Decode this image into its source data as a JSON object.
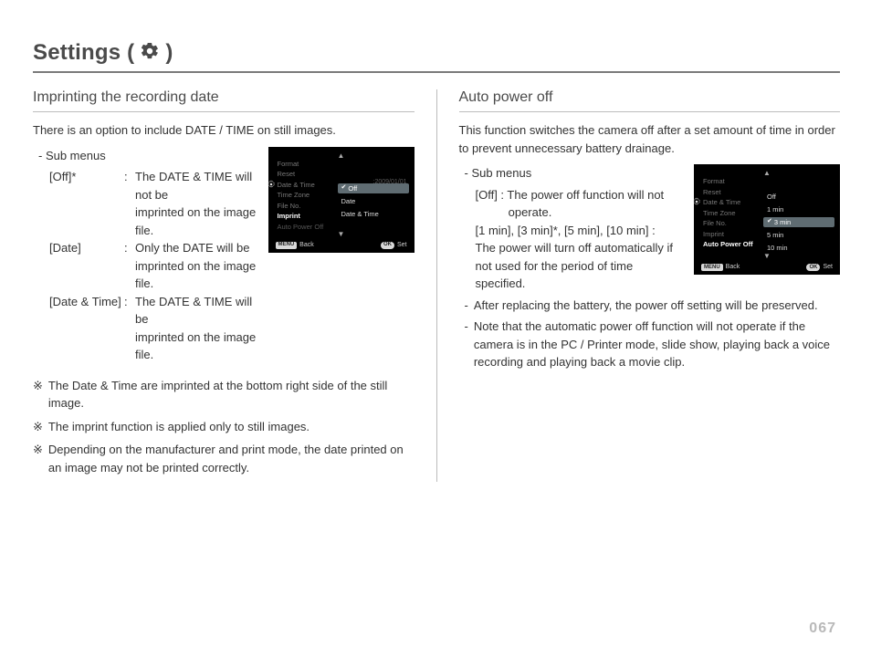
{
  "page_title_prefix": "Settings ( ",
  "page_title_suffix": " )",
  "page_number": "067",
  "left": {
    "heading": "Imprinting the recording date",
    "intro": "There is an option to include DATE / TIME on still images.",
    "submenu_label": "- Sub menus",
    "defs": [
      {
        "key": "[Off]*",
        "sep": ":",
        "val_1": "The DATE & TIME will not be",
        "val_2": "imprinted on the image file."
      },
      {
        "key": "[Date]",
        "sep": ":",
        "val_1": "Only the DATE will be",
        "val_2": "imprinted on the image file."
      },
      {
        "key": "[Date & Time]",
        "sep": ":",
        "val_1": "The DATE & TIME will be",
        "val_2": "imprinted on the image file."
      }
    ],
    "notes_sym": "※",
    "notes": [
      "The Date & Time are imprinted at the bottom right side of the still image.",
      "The imprint function is applied only to still images.",
      "Depending on the manufacturer and print mode, the date printed on an image may not be printed correctly."
    ],
    "cam": {
      "menu_items": [
        {
          "label": "Format",
          "style": "dim"
        },
        {
          "label": "Reset",
          "style": "dim"
        },
        {
          "label": "Date & Time",
          "style": "dim",
          "right_value": ":2009/01/01"
        },
        {
          "label": "Time Zone",
          "style": "dim"
        },
        {
          "label": "File No.",
          "style": "dim"
        },
        {
          "label": "Imprint",
          "style": "active"
        },
        {
          "label": "Auto Power Off",
          "style": "dimmer"
        }
      ],
      "options": [
        {
          "label": "Off",
          "selected": true,
          "checked": true
        },
        {
          "label": "Date",
          "selected": false,
          "checked": false
        },
        {
          "label": "Date & Time",
          "selected": false,
          "checked": false
        }
      ],
      "footer_left_pill": "MENU",
      "footer_left_label": "Back",
      "footer_right_pill": "OK",
      "footer_right_label": "Set"
    }
  },
  "right": {
    "heading": "Auto power off",
    "intro": "This function switches the camera off after a set amount of time in order to prevent unnecessary battery drainage.",
    "submenu_label": "- Sub menus",
    "lines": [
      "[Off] : The power off function will not",
      "          operate.",
      "[1 min], [3 min]*, [5 min], [10 min] :",
      "The power will turn off automatically if",
      " not used for the period of time specified."
    ],
    "dashes": [
      "After replacing the battery, the power off setting will be preserved.",
      "Note that the automatic power off function will not operate if the camera is in the PC / Printer mode, slide show, playing back a voice recording and playing back a movie clip."
    ],
    "cam": {
      "menu_items": [
        {
          "label": "Format",
          "style": "dim"
        },
        {
          "label": "Reset",
          "style": "dim"
        },
        {
          "label": "Date & Time",
          "style": "dim"
        },
        {
          "label": "Time Zone",
          "style": "dim"
        },
        {
          "label": "File No.",
          "style": "dim"
        },
        {
          "label": "Imprint",
          "style": "dim"
        },
        {
          "label": "Auto Power Off",
          "style": "active"
        }
      ],
      "options": [
        {
          "label": "Off",
          "selected": false,
          "checked": false
        },
        {
          "label": "1 min",
          "selected": false,
          "checked": false
        },
        {
          "label": "3 min",
          "selected": true,
          "checked": true
        },
        {
          "label": "5 min",
          "selected": false,
          "checked": false
        },
        {
          "label": "10 min",
          "selected": false,
          "checked": false
        }
      ],
      "footer_left_pill": "MENU",
      "footer_left_label": "Back",
      "footer_right_pill": "OK",
      "footer_right_label": "Set"
    }
  }
}
